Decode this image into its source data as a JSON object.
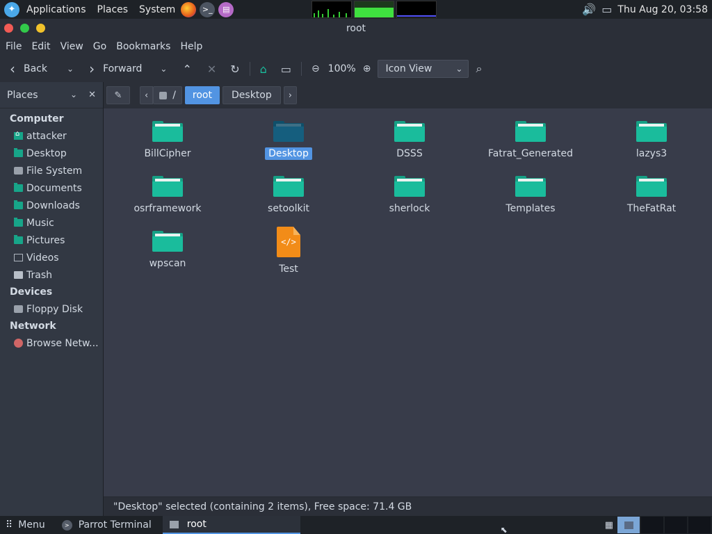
{
  "top_panel": {
    "applications": "Applications",
    "places": "Places",
    "system": "System",
    "clock": "Thu Aug 20, 03:58"
  },
  "window": {
    "title": "root"
  },
  "menubar": {
    "items": [
      "File",
      "Edit",
      "View",
      "Go",
      "Bookmarks",
      "Help"
    ]
  },
  "toolbar": {
    "back": "Back",
    "forward": "Forward",
    "zoom": "100%",
    "view_mode": "Icon View"
  },
  "sidebar": {
    "header": "Places",
    "sections": [
      {
        "heading": "Computer",
        "items": [
          "attacker",
          "Desktop",
          "File System",
          "Documents",
          "Downloads",
          "Music",
          "Pictures",
          "Videos",
          "Trash"
        ]
      },
      {
        "heading": "Devices",
        "items": [
          "Floppy Disk"
        ]
      },
      {
        "heading": "Network",
        "items": [
          "Browse Netw..."
        ]
      }
    ]
  },
  "pathbar": {
    "root_label": "/",
    "segments": [
      "root",
      "Desktop"
    ]
  },
  "files": [
    {
      "name": "BillCipher",
      "type": "folder"
    },
    {
      "name": "Desktop",
      "type": "folder",
      "selected": true
    },
    {
      "name": "DSSS",
      "type": "folder"
    },
    {
      "name": "Fatrat_Generated",
      "type": "folder"
    },
    {
      "name": "lazys3",
      "type": "folder"
    },
    {
      "name": "osrframework",
      "type": "folder"
    },
    {
      "name": "setoolkit",
      "type": "folder"
    },
    {
      "name": "sherlock",
      "type": "folder"
    },
    {
      "name": "Templates",
      "type": "folder"
    },
    {
      "name": "TheFatRat",
      "type": "folder"
    },
    {
      "name": "wpscan",
      "type": "folder"
    },
    {
      "name": "Test",
      "type": "code-file"
    }
  ],
  "statusbar": {
    "text": "\"Desktop\" selected (containing 2 items), Free space: 71.4 GB"
  },
  "bottom_panel": {
    "menu": "Menu",
    "terminal_task": "Parrot Terminal",
    "active_task": "root"
  },
  "colors": {
    "accent": "#5294e2",
    "folder": "#1abc9c",
    "file_icon": "#f28c18"
  }
}
